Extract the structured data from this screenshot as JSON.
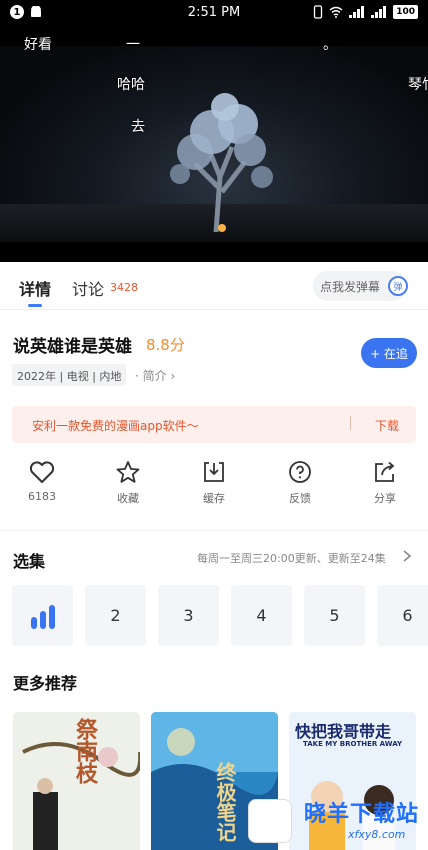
{
  "status_bar": {
    "badge": "1",
    "time": "2:51 PM",
    "battery": "100"
  },
  "video": {
    "danmu": [
      "好看",
      "一",
      "。",
      "哈哈",
      "琴竹",
      "去"
    ]
  },
  "tabs": {
    "details": "详情",
    "discuss": "讨论",
    "discuss_count": "3428",
    "danmu_placeholder": "点我发弹幕",
    "danmu_toggle": "弹"
  },
  "show": {
    "title": "说英雄谁是英雄",
    "score": "8.8分",
    "follow_label": "+ 在追",
    "tags": "2022年 | 电视 | 内地",
    "intro_label": "· 简介 ›"
  },
  "ad": {
    "text": "安利一款免费的漫画app软件〜",
    "separator": "|",
    "download": "下载"
  },
  "actions": [
    {
      "label": "6183",
      "icon": "heart-icon"
    },
    {
      "label": "收藏",
      "icon": "star-icon"
    },
    {
      "label": "缓存",
      "icon": "download-icon"
    },
    {
      "label": "反馈",
      "icon": "question-icon"
    },
    {
      "label": "分享",
      "icon": "share-icon"
    }
  ],
  "episodes": {
    "title": "选集",
    "info": "每周一至周三20:00更新、更新至24集",
    "items": [
      "2",
      "3",
      "4",
      "5",
      "6"
    ]
  },
  "recommend": {
    "title": "更多推荐",
    "posters": [
      {
        "text": "祭南枝",
        "bg": "#eef0ea"
      },
      {
        "text": "终极笔记",
        "bg": "#2b86c4"
      },
      {
        "text": "快把我哥带走",
        "sub": "TAKE MY BROTHER AWAY",
        "bg": "#eaf3fb"
      }
    ]
  },
  "watermark": {
    "text": "晓羊下载站",
    "sub": "xfxy8.com"
  }
}
